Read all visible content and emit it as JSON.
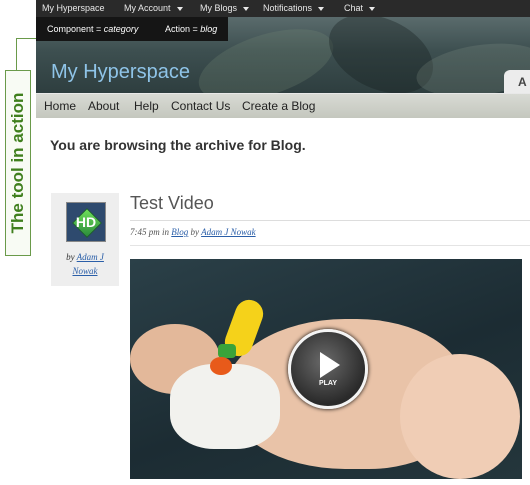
{
  "annotation": {
    "label": "The tool in action"
  },
  "admin_bar": {
    "site": "My Hyperspace",
    "items": [
      {
        "label": "My Account"
      },
      {
        "label": "My Blogs"
      },
      {
        "label": "Notifications"
      },
      {
        "label": "Chat"
      }
    ]
  },
  "tooltip": {
    "component_key": "Component = ",
    "component_value": "category",
    "action_key": "Action = ",
    "action_value": "blog"
  },
  "header": {
    "site_title": "My Hyperspace",
    "tab_partial": "A"
  },
  "nav": {
    "items": [
      {
        "label": "Home"
      },
      {
        "label": "About"
      },
      {
        "label": "Help"
      },
      {
        "label": "Contact Us"
      },
      {
        "label": "Create a Blog"
      }
    ]
  },
  "archive": {
    "message": "You are browsing the archive for Blog."
  },
  "post": {
    "title": "Test Video",
    "time": "7:45 pm",
    "in_text": "in",
    "category": "Blog",
    "by_text": "by",
    "author": "Adam J Nowak"
  },
  "author_box": {
    "avatar_text": "HD",
    "by_text": "by",
    "author_line1": "Adam J",
    "author_line2": "Nowak"
  },
  "video": {
    "play_label": "PLAY",
    "play_icon": "play-icon"
  },
  "colors": {
    "admin_bar_bg": "#2a2a2a",
    "site_title": "#8fc4e8",
    "link": "#2a5ea8",
    "annotation_green": "#3f7f1d"
  }
}
